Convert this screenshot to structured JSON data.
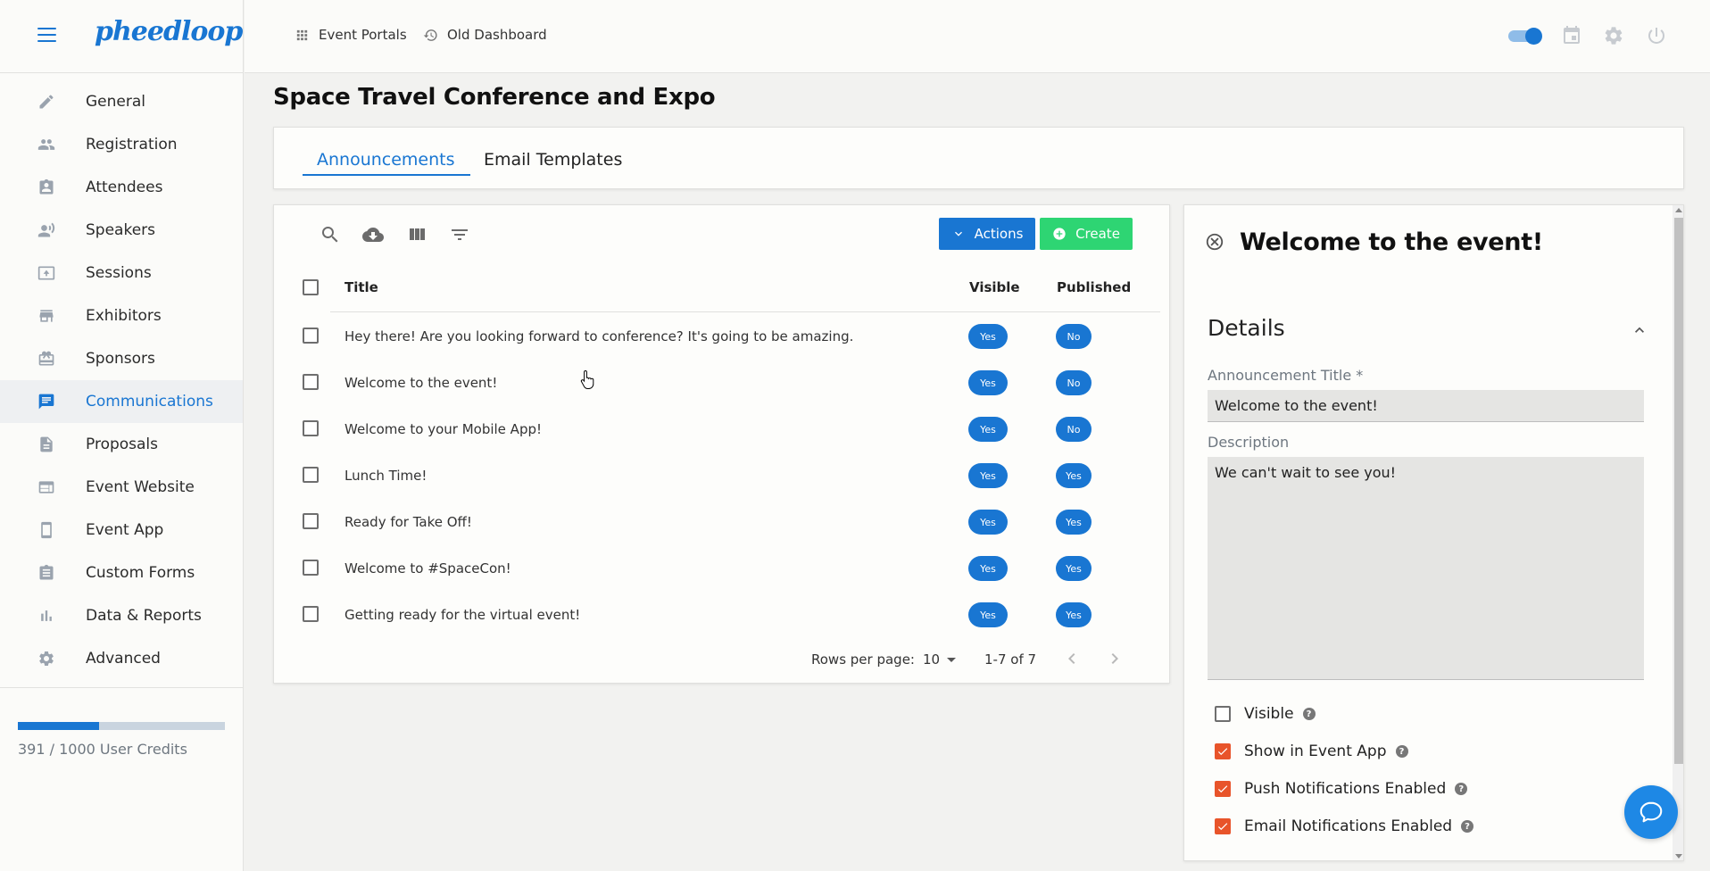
{
  "brand": {
    "logo_text": "pheedloop"
  },
  "sidebar": {
    "items": [
      {
        "label": "General",
        "icon": "pencil-icon",
        "active": false
      },
      {
        "label": "Registration",
        "icon": "people-icon",
        "active": false
      },
      {
        "label": "Attendees",
        "icon": "badge-icon",
        "active": false
      },
      {
        "label": "Speakers",
        "icon": "speaker-icon",
        "active": false
      },
      {
        "label": "Sessions",
        "icon": "session-icon",
        "active": false
      },
      {
        "label": "Exhibitors",
        "icon": "store-icon",
        "active": false
      },
      {
        "label": "Sponsors",
        "icon": "gift-icon",
        "active": false
      },
      {
        "label": "Communications",
        "icon": "chat-icon",
        "active": true
      },
      {
        "label": "Proposals",
        "icon": "document-icon",
        "active": false
      },
      {
        "label": "Event Website",
        "icon": "website-icon",
        "active": false
      },
      {
        "label": "Event App",
        "icon": "phone-icon",
        "active": false
      },
      {
        "label": "Custom Forms",
        "icon": "clipboard-icon",
        "active": false
      },
      {
        "label": "Data & Reports",
        "icon": "bar-chart-icon",
        "active": false
      },
      {
        "label": "Advanced",
        "icon": "gear-icon",
        "active": false
      }
    ],
    "credits": {
      "used": 391,
      "total": 1000,
      "text": "391 / 1000 User Credits"
    }
  },
  "topbar": {
    "event_portals": "Event Portals",
    "old_dashboard": "Old Dashboard"
  },
  "page": {
    "title": "Space Travel Conference and Expo"
  },
  "tabs": [
    {
      "label": "Announcements",
      "active": true
    },
    {
      "label": "Email Templates",
      "active": false
    }
  ],
  "toolbar": {
    "actions_label": "Actions",
    "create_label": "Create"
  },
  "table": {
    "columns": {
      "title": "Title",
      "visible": "Visible",
      "published": "Published"
    },
    "rows": [
      {
        "title": "Hey there! Are you looking forward to conference? It's going to be amazing.",
        "visible": "Yes",
        "published": "No"
      },
      {
        "title": "Welcome to the event!",
        "visible": "Yes",
        "published": "No"
      },
      {
        "title": "Welcome to your Mobile App!",
        "visible": "Yes",
        "published": "No"
      },
      {
        "title": "Lunch Time!",
        "visible": "Yes",
        "published": "Yes"
      },
      {
        "title": "Ready for Take Off!",
        "visible": "Yes",
        "published": "Yes"
      },
      {
        "title": "Welcome to #SpaceCon!",
        "visible": "Yes",
        "published": "Yes"
      },
      {
        "title": "Getting ready for the virtual event!",
        "visible": "Yes",
        "published": "Yes"
      }
    ],
    "pagination": {
      "rows_per_page_label": "Rows per page:",
      "rows_per_page": "10",
      "range": "1-7 of 7"
    }
  },
  "detail": {
    "title": "Welcome to the event!",
    "section_title": "Details",
    "announcement_title_label": "Announcement Title *",
    "announcement_title_value": "Welcome to the event!",
    "description_label": "Description",
    "description_value": "We can't wait to see you!",
    "checkboxes": [
      {
        "label": "Visible",
        "checked": false
      },
      {
        "label": "Show in Event App",
        "checked": true
      },
      {
        "label": "Push Notifications Enabled",
        "checked": true
      },
      {
        "label": "Email Notifications Enabled",
        "checked": true
      }
    ]
  },
  "colors": {
    "accent": "#1976d2",
    "create": "#2ed573",
    "checkbox_on": "#e8542a"
  }
}
